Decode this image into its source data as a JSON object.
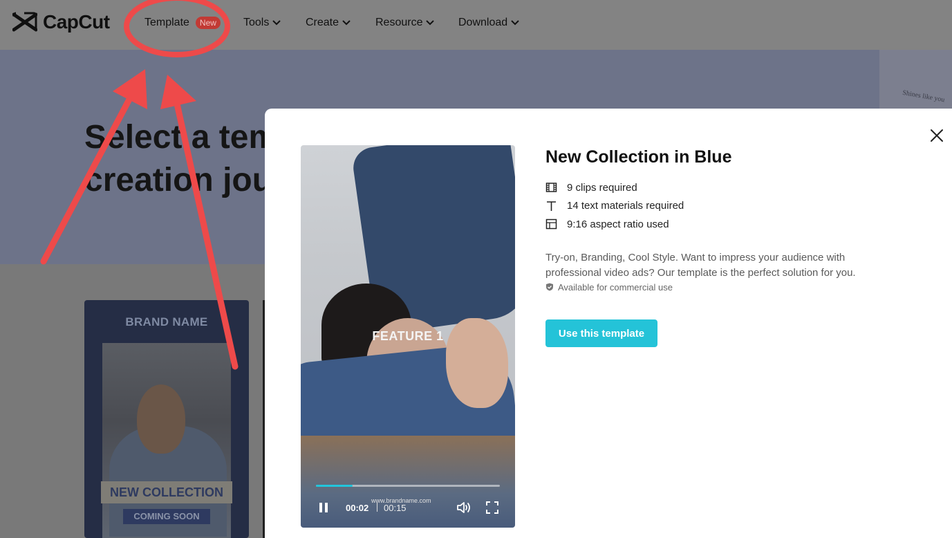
{
  "nav": {
    "logo_text": "CapCut",
    "template_label": "Template",
    "template_badge": "New",
    "tools_label": "Tools",
    "create_label": "Create",
    "resource_label": "Resource",
    "download_label": "Download"
  },
  "hero": {
    "title_line1": "Select a tem",
    "title_line2": "creation jou",
    "deco_text": "Shines like you"
  },
  "card": {
    "brand": "BRAND NAME",
    "headline": "NEW COLLECTION",
    "subline": "COMING SOON"
  },
  "modal": {
    "title": "New Collection in Blue",
    "clips": "9 clips required",
    "texts": "14 text materials required",
    "ratio": "9:16 aspect ratio used",
    "description": "Try-on, Branding, Cool Style. Want to impress your audience with professional video ads? Our template is the perfect solution for you.",
    "commercial": "Available for commercial use",
    "use_button": "Use this template"
  },
  "video": {
    "overlay_text": "FEATURE 1",
    "watermark": "www.brandname.com",
    "current_time": "00:02",
    "total_time": "00:15",
    "progress": 0.2
  },
  "colors": {
    "accent": "#24c3d8",
    "annotation": "#ee4a4a",
    "badge": "#c23a34"
  },
  "icons": [
    "capcut-logo-icon",
    "chevron-down-icon",
    "close-icon",
    "film-icon",
    "text-icon",
    "layout-icon",
    "shield-check-icon",
    "pause-icon",
    "volume-icon",
    "fullscreen-icon"
  ]
}
